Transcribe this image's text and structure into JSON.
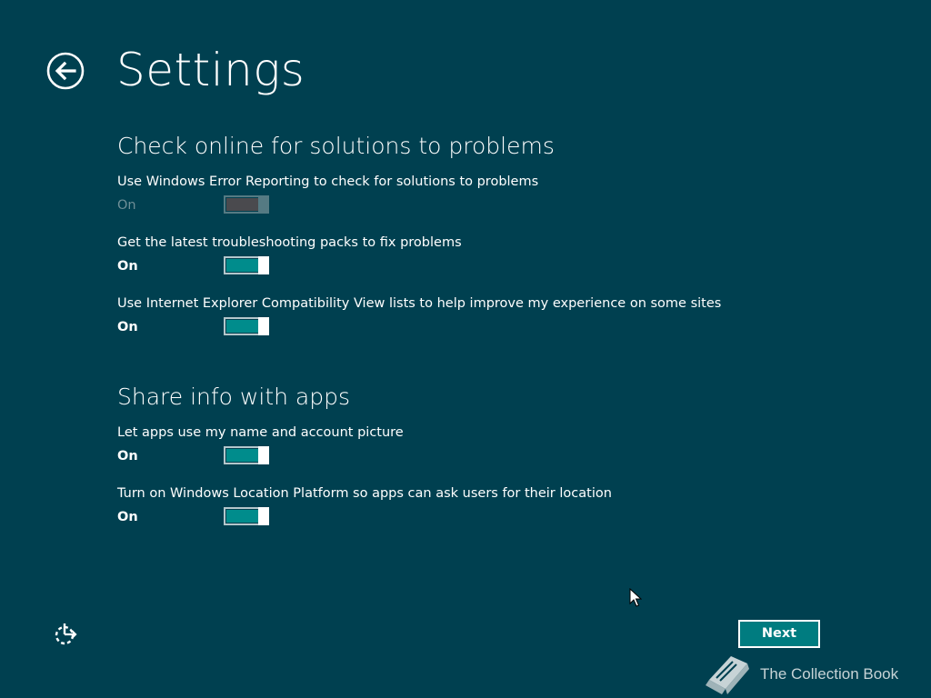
{
  "page": {
    "title": "Settings",
    "background_color": "#004050",
    "accent_color": "#008c8c"
  },
  "sections": [
    {
      "heading": "Check online for solutions to problems",
      "settings": [
        {
          "label": "Use Windows Error Reporting to check for solutions to problems",
          "state": "On",
          "enabled": false
        },
        {
          "label": "Get the latest troubleshooting packs to fix problems",
          "state": "On",
          "enabled": true
        },
        {
          "label": "Use Internet Explorer Compatibility View lists to help improve my experience on some sites",
          "state": "On",
          "enabled": true
        }
      ]
    },
    {
      "heading": "Share info with apps",
      "settings": [
        {
          "label": "Let apps use my name and account picture",
          "state": "On",
          "enabled": true
        },
        {
          "label": "Turn on Windows Location Platform so apps can ask users for their location",
          "state": "On",
          "enabled": true
        }
      ]
    }
  ],
  "footer": {
    "next_label": "Next",
    "ease_of_access_icon": "ease-of-access-icon",
    "back_icon": "back-arrow-icon"
  },
  "watermark": {
    "text": "The Collection Book",
    "icon": "book-icon"
  }
}
